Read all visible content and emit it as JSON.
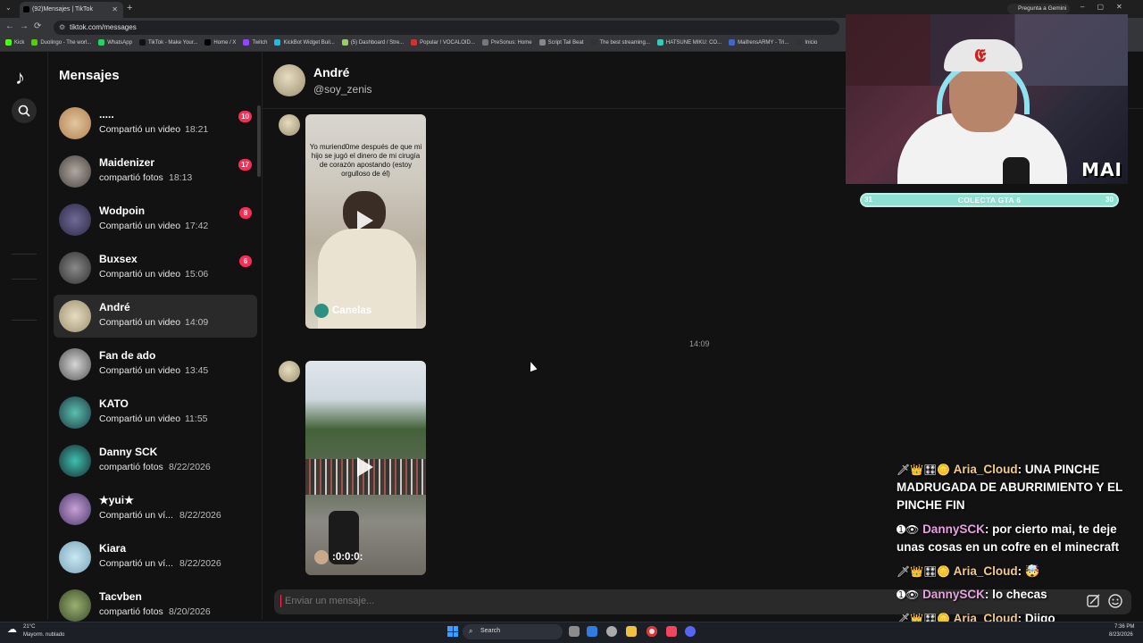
{
  "browser": {
    "tab_title": "(92)Mensajes | TikTok",
    "url": "tiktok.com/messages",
    "gemini_label": "Pregunta a Gemini",
    "bookmarks": [
      "Kick",
      "Duolingo - The worl...",
      "WhatsApp",
      "TikTok - Make Your...",
      "Home / X",
      "Twitch",
      "KickBot Widget Buil...",
      "(5) Dashboard / Stre...",
      "Popular ! VOCALOID...",
      "PreSonus: Home",
      "Script Tail Beat",
      "The best streaming...",
      "HATSUNE MIKU: CO...",
      "MaifrensARMY - Tri...",
      "Inicio"
    ]
  },
  "inbox": {
    "title": "Mensajes",
    "conversations": [
      {
        "name": ".....",
        "preview": "Compartió un video",
        "time": "18:21",
        "badge": "10"
      },
      {
        "name": "Maidenizer",
        "preview": "compartió fotos",
        "time": "18:13",
        "badge": "17"
      },
      {
        "name": "Wodpoin",
        "preview": "Compartió un video",
        "time": "17:42",
        "badge": "8"
      },
      {
        "name": "Buxsex",
        "preview": "Compartió un video",
        "time": "15:06",
        "badge": "6"
      },
      {
        "name": "André",
        "preview": "Compartió un video",
        "time": "14:09",
        "badge": ""
      },
      {
        "name": "Fan de ado",
        "preview": "Compartió un video",
        "time": "13:45",
        "badge": ""
      },
      {
        "name": "KATO",
        "preview": "Compartió un video",
        "time": "11:55",
        "badge": ""
      },
      {
        "name": "Danny SCK",
        "preview": "compartió fotos",
        "time": "8/22/2026",
        "badge": ""
      },
      {
        "name": "★yui★",
        "preview": "Compartió un ví...",
        "time": "8/22/2026",
        "badge": ""
      },
      {
        "name": "Kiara",
        "preview": "Compartió un ví...",
        "time": "8/22/2026",
        "badge": ""
      },
      {
        "name": "Tacvben",
        "preview": "compartió fotos",
        "time": "8/20/2026",
        "badge": ""
      }
    ]
  },
  "chat": {
    "name": "André",
    "username": "@soy_zenis",
    "video1": {
      "caption": "Yo muriend0me después de que mi hijo se jugó el dinero de mi cirugía de corazón apostando (estoy orgulloso de él)",
      "author": "Canelas"
    },
    "timestamp": "14:09",
    "video2": {
      "author": ":0:0:0:"
    },
    "composer_placeholder": "Enviar un mensaje..."
  },
  "stream": {
    "webcam_label": "MAI",
    "goal": {
      "left": "31",
      "label": "COLECTA GTA 6",
      "right": "30"
    },
    "chat": [
      {
        "user": "Aria_Cloud",
        "type": "aria",
        "text": "UNA PINCHE MADRUGADA DE ABURRIMIENTO Y EL PINCHE FIN"
      },
      {
        "user": "DannySCK",
        "type": "danny",
        "text": "por cierto mai, te deje unas cosas en un cofre en el minecraft"
      },
      {
        "user": "Aria_Cloud",
        "type": "aria",
        "text": "🤯"
      },
      {
        "user": "DannySCK",
        "type": "danny",
        "text": "lo checas"
      },
      {
        "user": "Aria_Cloud",
        "type": "aria",
        "text": "Diigo"
      }
    ]
  },
  "taskbar": {
    "weather_temp": "21°C",
    "weather_desc": "Mayorm. nublado",
    "search_label": "Search",
    "time": "7:36 PM",
    "date": "8/23/2026"
  },
  "colors": {
    "accent": "#fe2c55",
    "aria": "#f2c98a",
    "danny": "#e6a0e0",
    "goal": "#8ee0d0"
  }
}
